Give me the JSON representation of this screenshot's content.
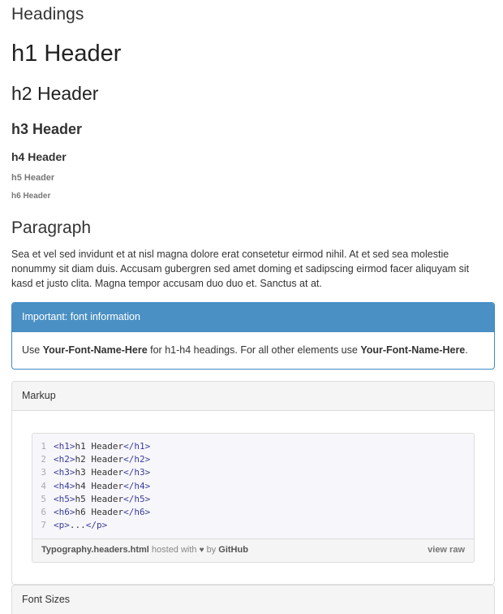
{
  "sections": {
    "headings_title": "Headings",
    "paragraph_title": "Paragraph",
    "font_sizes_title": "Font Sizes"
  },
  "headings": {
    "h1": "h1 Header",
    "h2": "h2 Header",
    "h3": "h3 Header",
    "h4": "h4 Header",
    "h5": "h5 Header",
    "h6": "h6 Header"
  },
  "paragraph": {
    "text": "Sea et vel sed invidunt et at nisl magna dolore erat consetetur eirmod nihil. At et sed sea molestie nonummy sit diam duis. Accusam gubergren sed amet doming et sadipscing eirmod facer aliquyam sit kasd et justo clita. Magna tempor accusam duo duo et. Sanctus at at."
  },
  "info_panel": {
    "heading": "Important: font information",
    "body_prefix": "Use ",
    "font_name_1": "Your-Font-Name-Here",
    "body_middle": " for h1-h4 headings. For all other elements use ",
    "font_name_2": "Your-Font-Name-Here",
    "body_suffix": ".",
    "accent_color": "#4a90c4"
  },
  "markup_panel": {
    "heading": "Markup",
    "code_lines": [
      {
        "n": "1",
        "open": "<h1>",
        "text": "h1 Header",
        "close": "</h1>"
      },
      {
        "n": "2",
        "open": "<h2>",
        "text": "h2 Header",
        "close": "</h2>"
      },
      {
        "n": "3",
        "open": "<h3>",
        "text": "h3 Header",
        "close": "</h3>"
      },
      {
        "n": "4",
        "open": "<h4>",
        "text": "h4 Header",
        "close": "</h4>"
      },
      {
        "n": "5",
        "open": "<h5>",
        "text": "h5 Header",
        "close": "</h5>"
      },
      {
        "n": "6",
        "open": "<h6>",
        "text": "h6 Header",
        "close": "</h6>"
      },
      {
        "n": "7",
        "open": "<p>",
        "text": "...",
        "close": "</p>"
      }
    ],
    "gist_filename": "Typography.headers.html",
    "gist_hosted_with": " hosted with ",
    "gist_heart": "♥",
    "gist_by": " by ",
    "gist_provider": "GitHub",
    "view_raw_label": "view raw"
  }
}
